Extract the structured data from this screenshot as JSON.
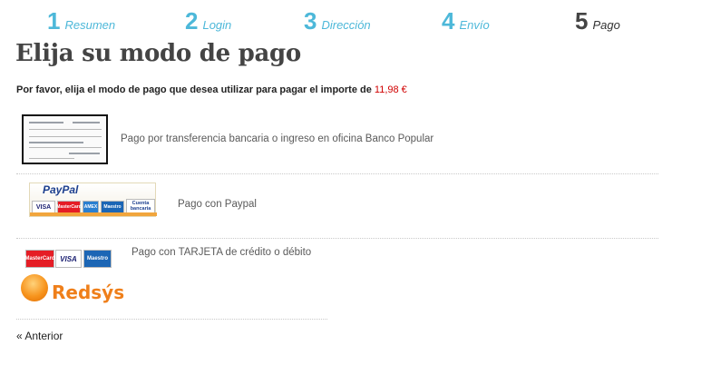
{
  "steps": [
    {
      "num": "1",
      "label": "Resumen"
    },
    {
      "num": "2",
      "label": "Login"
    },
    {
      "num": "3",
      "label": "Dirección"
    },
    {
      "num": "4",
      "label": "Envío"
    },
    {
      "num": "5",
      "label": "Pago"
    }
  ],
  "page_title": "Elija su modo de pago",
  "intro": {
    "text": "Por favor, elija el modo de pago que desea utilizar para pagar el importe de",
    "amount": "11,98 €"
  },
  "payment_options": {
    "bank_transfer": "Pago por transferencia bancaria o ingreso en oficina Banco Popular",
    "paypal": "Pago con Paypal",
    "card": "Pago con TARJETA de crédito o débito"
  },
  "paypal_logo": {
    "brand": "PayPal",
    "cards": [
      "VISA",
      "MasterCard",
      "AMEX",
      "Maestro",
      "Cuenta bancaria"
    ]
  },
  "card_logos": [
    "MasterCard",
    "VISA",
    "Maestro"
  ],
  "redsys_logo": "Redsýs",
  "back_link": "« Anterior",
  "colors": {
    "step_accent": "#4db8d9",
    "amount": "#d00000",
    "redsys": "#ef7f1a"
  }
}
